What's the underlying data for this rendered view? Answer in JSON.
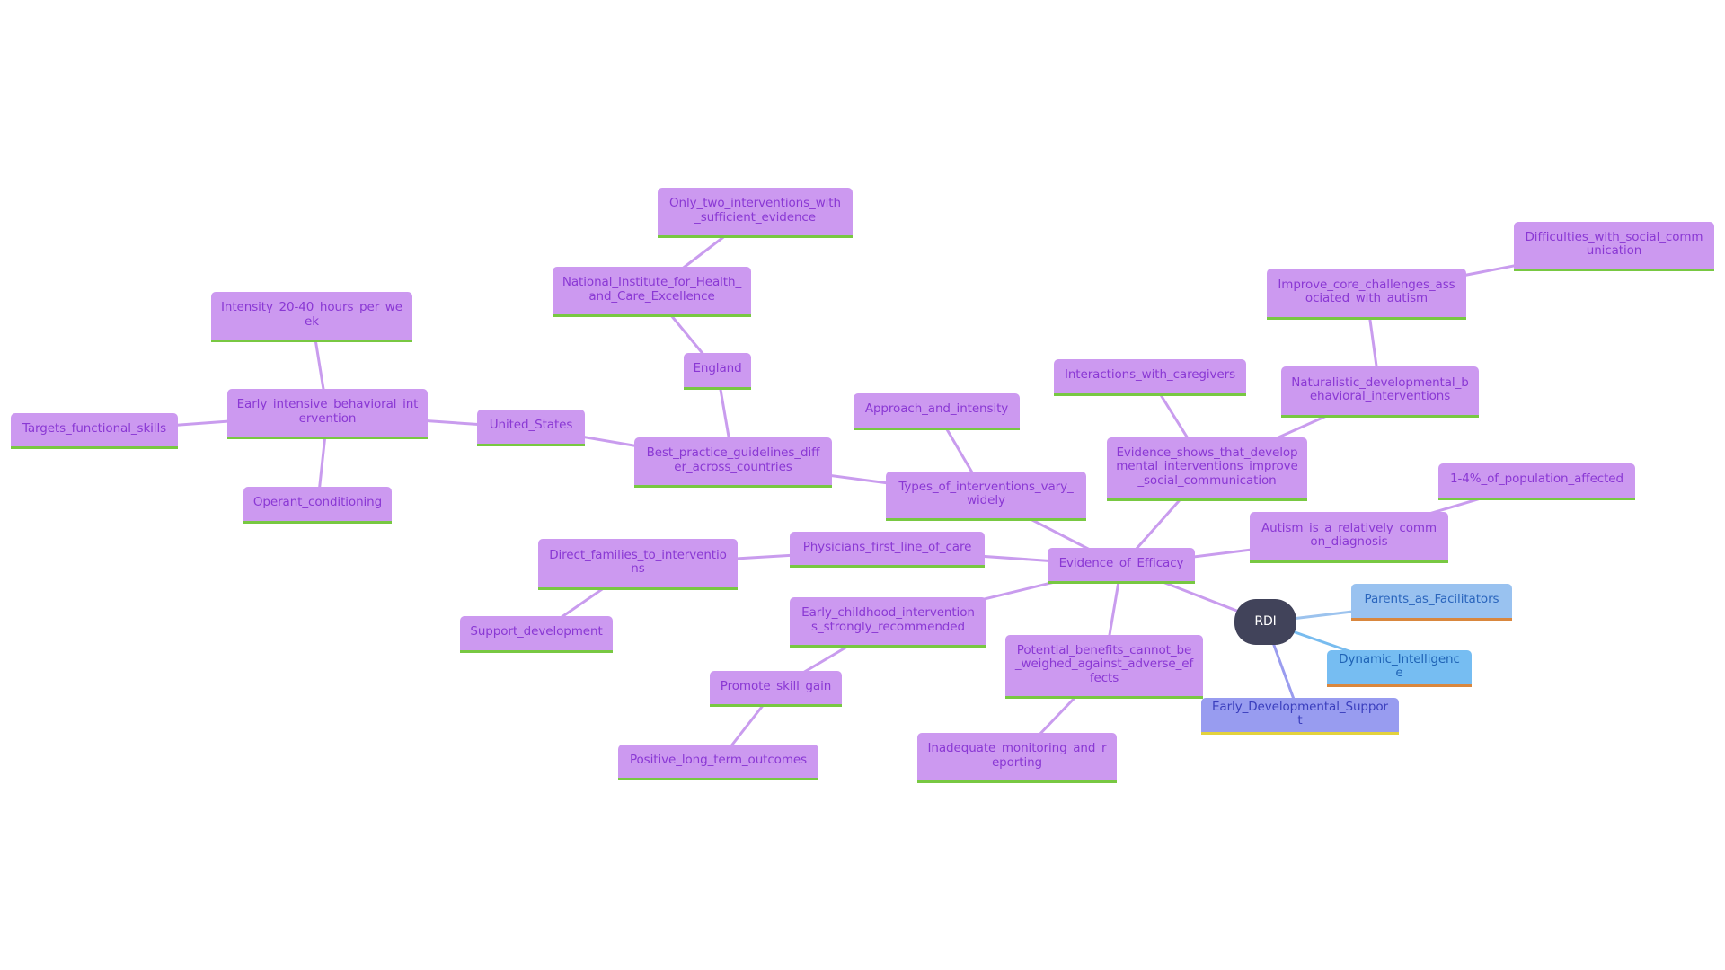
{
  "root": {
    "id": "rdi",
    "label": "RDI"
  },
  "colors": {
    "root_fill": "#41435a",
    "purple_fill": "#cc99f0",
    "purple_text": "#8a38d4",
    "purple_link": "#c99cee",
    "green_underline": "#78c842",
    "blue_fill_light": "#99c2f0",
    "blue_fill": "#76bdf2",
    "orange_underline": "#d9873e",
    "indigo_fill": "#989cf0",
    "yellow_underline": "#e3d23c"
  },
  "nodes": [
    {
      "id": "parents",
      "label": "Parents_as_Facilitators",
      "parent": "rdi",
      "style": "blue1"
    },
    {
      "id": "dynamic",
      "label": "Dynamic_Intelligence",
      "parent": "rdi",
      "style": "blue2"
    },
    {
      "id": "early_dev",
      "label": "Early_Developmental_Support",
      "parent": "rdi",
      "style": "indigo"
    },
    {
      "id": "efficacy",
      "label": "Evidence_of_Efficacy",
      "parent": "rdi",
      "style": "purple"
    },
    {
      "id": "autism",
      "label": "Autism_is_a_relatively_common_diagnosis",
      "parent": "efficacy",
      "style": "purple"
    },
    {
      "id": "one_four",
      "label": "1-4%_of_population_affected",
      "parent": "autism",
      "style": "purple"
    },
    {
      "id": "evidence_shows",
      "label": "Evidence_shows_that_developmental_interventions_improve_social_communication",
      "parent": "efficacy",
      "style": "purple"
    },
    {
      "id": "interactions",
      "label": "Interactions_with_caregivers",
      "parent": "evidence_shows",
      "style": "purple"
    },
    {
      "id": "naturalistic",
      "label": "Naturalistic_developmental_behavioral_interventions",
      "parent": "evidence_shows",
      "style": "purple"
    },
    {
      "id": "improve",
      "label": "Improve_core_challenges_associated_with_autism",
      "parent": "naturalistic",
      "style": "purple"
    },
    {
      "id": "difficulties",
      "label": "Difficulties_with_social_communication",
      "parent": "improve",
      "style": "purple"
    },
    {
      "id": "types",
      "label": "Types_of_interventions_vary_widely",
      "parent": "efficacy",
      "style": "purple"
    },
    {
      "id": "approach",
      "label": "Approach_and_intensity",
      "parent": "types",
      "style": "purple"
    },
    {
      "id": "best",
      "label": "Best_practice_guidelines_differ_across_countries",
      "parent": "types",
      "style": "purple"
    },
    {
      "id": "england",
      "label": "England",
      "parent": "best",
      "style": "purple"
    },
    {
      "id": "nice",
      "label": "National_Institute_for_Health_and_Care_Excellence",
      "parent": "england",
      "style": "purple"
    },
    {
      "id": "only_two",
      "label": "Only_two_interventions_with_sufficient_evidence",
      "parent": "nice",
      "style": "purple"
    },
    {
      "id": "us",
      "label": "United_States",
      "parent": "best",
      "style": "purple"
    },
    {
      "id": "eibi",
      "label": "Early_intensive_behavioral_intervention",
      "parent": "us",
      "style": "purple"
    },
    {
      "id": "intensity",
      "label": "Intensity_20-40_hours_per_week",
      "parent": "eibi",
      "style": "purple"
    },
    {
      "id": "targets",
      "label": "Targets_functional_skills",
      "parent": "eibi",
      "style": "purple"
    },
    {
      "id": "operant",
      "label": "Operant_conditioning",
      "parent": "eibi",
      "style": "purple"
    },
    {
      "id": "physicians",
      "label": "Physicians_first_line_of_care",
      "parent": "efficacy",
      "style": "purple"
    },
    {
      "id": "direct",
      "label": "Direct_families_to_interventions",
      "parent": "physicians",
      "style": "purple"
    },
    {
      "id": "support",
      "label": "Support_development",
      "parent": "direct",
      "style": "purple"
    },
    {
      "id": "early_child",
      "label": "Early_childhood_interventions_strongly_recommended",
      "parent": "efficacy",
      "style": "purple"
    },
    {
      "id": "promote",
      "label": "Promote_skill_gain",
      "parent": "early_child",
      "style": "purple"
    },
    {
      "id": "positive",
      "label": "Positive_long_term_outcomes",
      "parent": "promote",
      "style": "purple"
    },
    {
      "id": "potential",
      "label": "Potential_benefits_cannot_be_weighed_against_adverse_effects",
      "parent": "efficacy",
      "style": "purple"
    },
    {
      "id": "inadequate",
      "label": "Inadequate_monitoring_and_reporting",
      "parent": "potential",
      "style": "purple"
    }
  ]
}
